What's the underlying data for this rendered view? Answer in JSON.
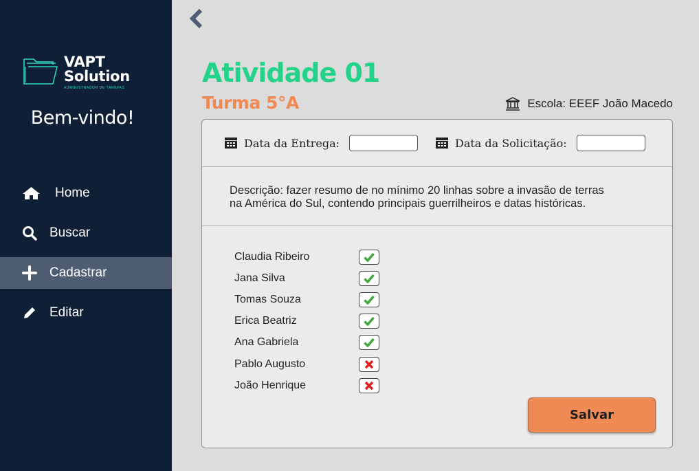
{
  "sidebar": {
    "logo": {
      "name_line1": "VAPT",
      "name_line2": "Solution",
      "subtitle": "ADMINISTRADOR DE TAREFAS",
      "accent": "#2fd6c4"
    },
    "welcome": "Bem-vindo!",
    "items": [
      {
        "label": "Home",
        "icon": "home-icon"
      },
      {
        "label": "Buscar",
        "icon": "search-icon"
      },
      {
        "label": "Cadastrar",
        "icon": "plus-icon",
        "active": true
      },
      {
        "label": "Editar",
        "icon": "pencil-icon"
      }
    ]
  },
  "header": {
    "title": "Atividade 01",
    "turma": "Turma 5°A",
    "escola": "Escola: EEEF João Macedo"
  },
  "form": {
    "entrega_label": "Data da Entrega:",
    "entrega_value": "",
    "solicitacao_label": "Data da Solicitação:",
    "solicitacao_value": "",
    "descricao_line1": "Descrição: fazer resumo de no mínimo 20 linhas sobre a invasão de terras",
    "descricao_line2": "na América do Sul, contendo principais guerrilheiros e datas históricas."
  },
  "students": [
    {
      "name": "Claudia Ribeiro",
      "done": true
    },
    {
      "name": "Jana Silva",
      "done": true
    },
    {
      "name": "Tomas Souza",
      "done": true
    },
    {
      "name": "Erica Beatriz",
      "done": true
    },
    {
      "name": "Ana Gabriela",
      "done": true
    },
    {
      "name": "Pablo Augusto",
      "done": false
    },
    {
      "name": "João Henrique",
      "done": false
    }
  ],
  "save_label": "Salvar",
  "colors": {
    "sidebar": "#0f1f36",
    "title": "#23d389",
    "turma": "#ef8a55",
    "check": "#3fa63a",
    "cross": "#e02020",
    "save": "#ef8a55"
  }
}
